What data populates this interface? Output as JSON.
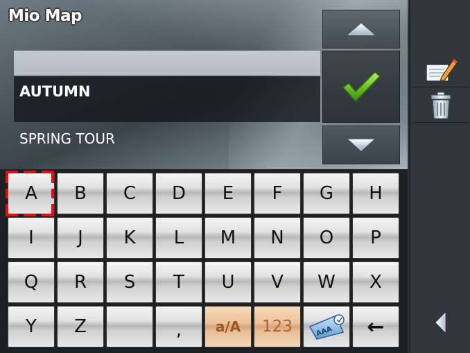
{
  "app": {
    "title": "Mio Map"
  },
  "list": {
    "items": [
      {
        "label": ""
      },
      {
        "label": "AUTUMN",
        "selected": true
      },
      {
        "label": "SPRING TOUR"
      }
    ]
  },
  "controls": {
    "scroll_up_icon": "triangle-up-icon",
    "confirm_icon": "check-mark-icon",
    "scroll_down_icon": "triangle-down-icon"
  },
  "keyboard": {
    "rows": [
      [
        "A",
        "B",
        "C",
        "D",
        "E",
        "F",
        "G",
        "H"
      ],
      [
        "I",
        "J",
        "K",
        "L",
        "M",
        "N",
        "O",
        "P"
      ],
      [
        "Q",
        "R",
        "S",
        "T",
        "U",
        "V",
        "W",
        "X"
      ],
      [
        "Y",
        "Z",
        "",
        ",",
        "a/A",
        "123",
        "AAA",
        "←"
      ]
    ],
    "focused_key": "A"
  },
  "side_panel": {
    "edit_icon": "edit-note-icon",
    "delete_icon": "trash-can-icon",
    "back_icon": "triangle-left-icon"
  },
  "colors": {
    "focus": "#e01010",
    "check": "#5fb320",
    "orange_key": "#eec39c"
  }
}
